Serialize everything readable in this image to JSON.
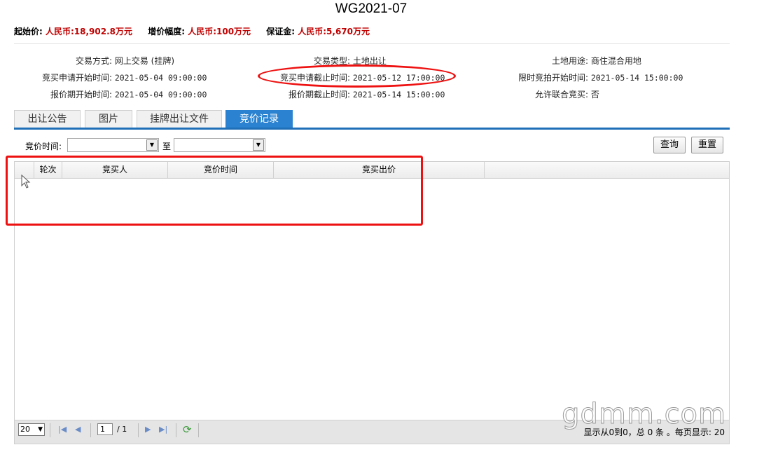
{
  "title": "WG2021-07",
  "prices": {
    "start_label": "起始价:",
    "start_value": "人民币:18,902.8万元",
    "increment_label": "增价幅度:",
    "increment_value": "人民币:100万元",
    "deposit_label": "保证金:",
    "deposit_value": "人民币:5,670万元"
  },
  "info": {
    "trade_mode_label": "交易方式:",
    "trade_mode_value": "网上交易 (挂牌)",
    "trade_type_label": "交易类型:",
    "trade_type_value": "土地出让",
    "land_use_label": "土地用途:",
    "land_use_value": "商住混合用地",
    "apply_start_label": "竞买申请开始时间:",
    "apply_start_value": "2021-05-04 09:00:00",
    "apply_end_label": "竞买申请截止时间:",
    "apply_end_value": "2021-05-12 17:00:00",
    "auction_start_label": "限时竞拍开始时间:",
    "auction_start_value": "2021-05-14 15:00:00",
    "quote_start_label": "报价期开始时间:",
    "quote_start_value": "2021-05-04 09:00:00",
    "quote_end_label": "报价期截止时间:",
    "quote_end_value": "2021-05-14 15:00:00",
    "joint_label": "允许联合竞买:",
    "joint_value": "否"
  },
  "tabs": [
    "出让公告",
    "图片",
    "挂牌出让文件",
    "竞价记录"
  ],
  "filter": {
    "time_label": "竞价时间:",
    "to_label": "至",
    "query_button": "查询",
    "reset_button": "重置"
  },
  "grid": {
    "columns": [
      "轮次",
      "竞买人",
      "竞价时间",
      "竞买出价"
    ],
    "page_size": "20",
    "page_current": "1",
    "page_of": "/ 1",
    "status": "显示从0到0，总 0 条 。每页显示: 20"
  },
  "watermark": "gdmm.com"
}
